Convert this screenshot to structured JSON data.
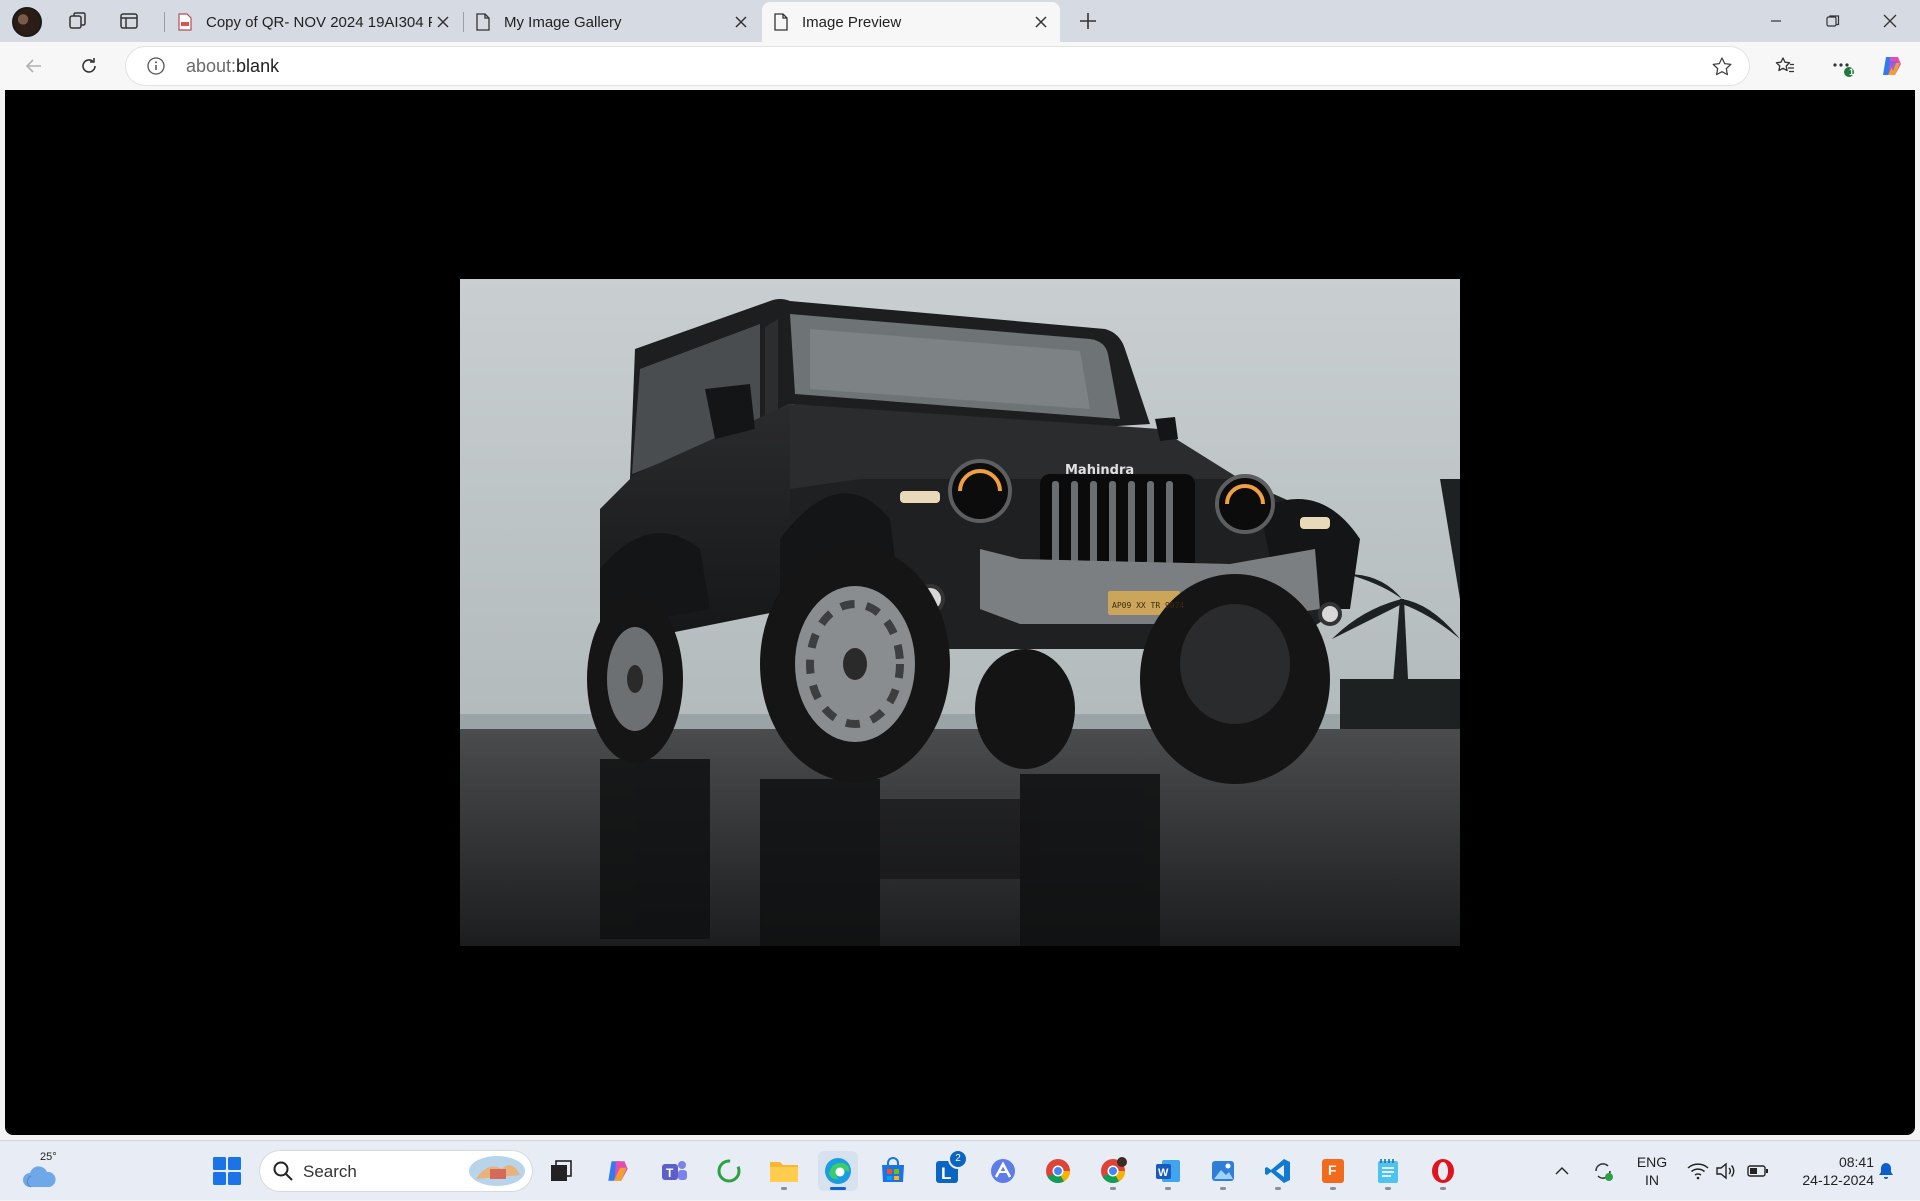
{
  "browser": {
    "tabs": [
      {
        "title": "Copy of QR- NOV 2024 19AI304 F",
        "favicon": "pdf-icon",
        "active": false
      },
      {
        "title": "My Image Gallery",
        "favicon": "page-icon",
        "active": false
      },
      {
        "title": "Image Preview",
        "favicon": "page-icon",
        "active": true
      }
    ],
    "address": {
      "url_dim": "about:",
      "url_main": "blank"
    },
    "extensions_badge": "1"
  },
  "page": {
    "image": {
      "subject": "black Mahindra Thar SUV on wet beach",
      "grille_text": "Mahindra",
      "plate_text": "AP09 XX TR 9074"
    }
  },
  "taskbar": {
    "weather_temp": "25°",
    "search_placeholder": "Search",
    "linkedin_badge": "2",
    "lang_line1": "ENG",
    "lang_line2": "IN",
    "time": "08:41",
    "date": "24-12-2024"
  },
  "colors": {
    "accent": "#0a64d6",
    "viewport_bg": "#000000",
    "tabstrip_bg": "#d6dae3"
  }
}
